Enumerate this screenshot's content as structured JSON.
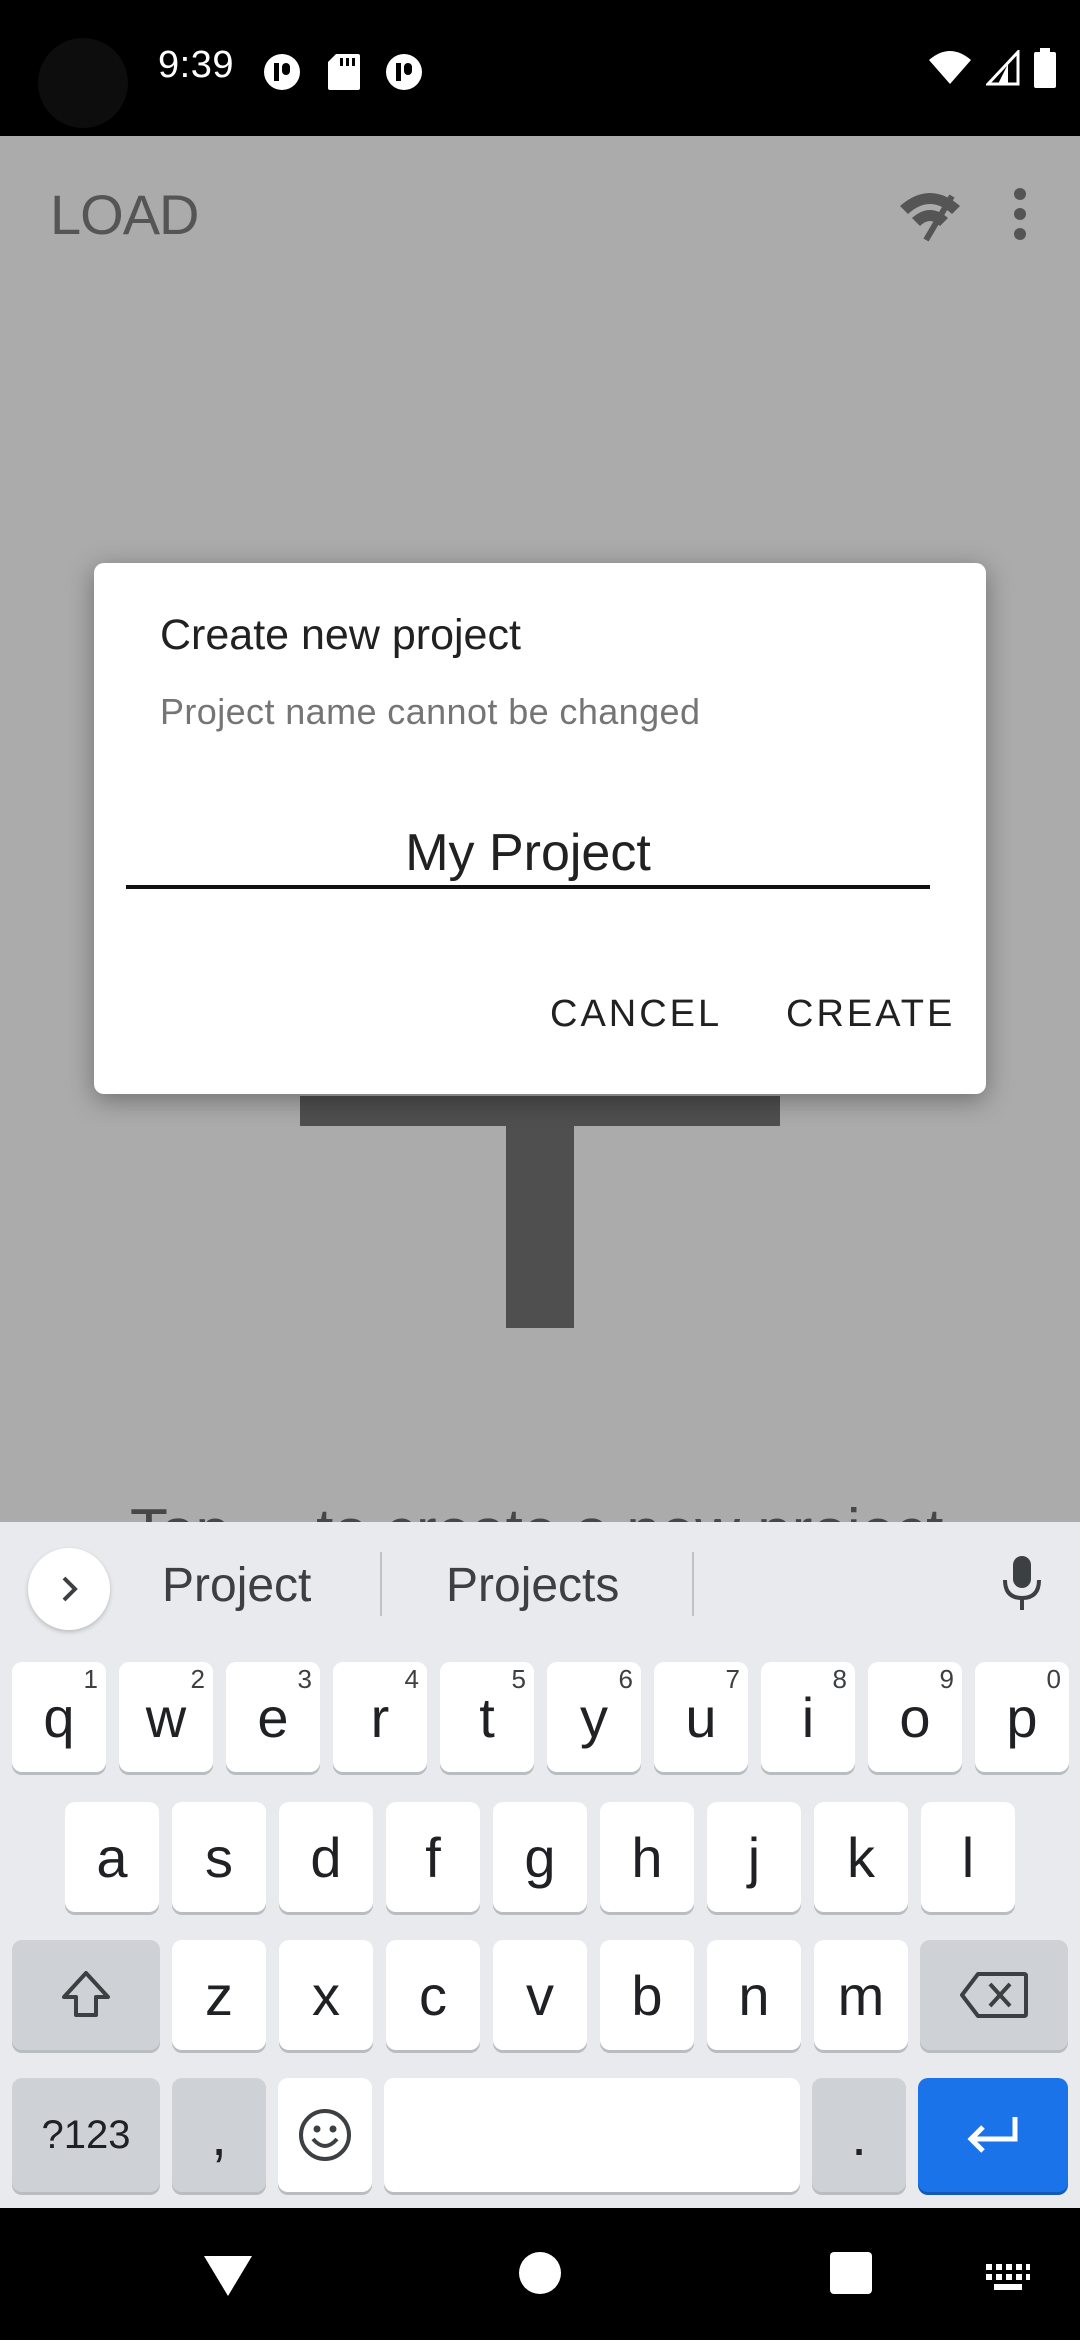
{
  "status_bar": {
    "time": "9:39",
    "notification_icons": [
      "notification-app-icon",
      "sd-card-icon",
      "notification-app-icon"
    ],
    "system_icons": [
      "wifi-icon",
      "cellular-signal-icon",
      "battery-icon"
    ]
  },
  "app_bar": {
    "title": "LOAD",
    "actions": [
      "wifi-off-icon",
      "more-vert-icon"
    ]
  },
  "background": {
    "partial_text": "Tap ... to create a new project"
  },
  "dialog": {
    "title": "Create new project",
    "subtitle": "Project name cannot be changed",
    "input_value": "My Project",
    "cancel_label": "CANCEL",
    "create_label": "CREATE"
  },
  "keyboard": {
    "suggestions": [
      "Project",
      "Projects"
    ],
    "row1": [
      {
        "label": "q",
        "hint": "1"
      },
      {
        "label": "w",
        "hint": "2"
      },
      {
        "label": "e",
        "hint": "3"
      },
      {
        "label": "r",
        "hint": "4"
      },
      {
        "label": "t",
        "hint": "5"
      },
      {
        "label": "y",
        "hint": "6"
      },
      {
        "label": "u",
        "hint": "7"
      },
      {
        "label": "i",
        "hint": "8"
      },
      {
        "label": "o",
        "hint": "9"
      },
      {
        "label": "p",
        "hint": "0"
      }
    ],
    "row2": [
      "a",
      "s",
      "d",
      "f",
      "g",
      "h",
      "j",
      "k",
      "l"
    ],
    "row3": [
      "z",
      "x",
      "c",
      "v",
      "b",
      "n",
      "m"
    ],
    "symbols_label": "?123",
    "comma_label": ",",
    "period_label": ".",
    "accent_color": "#1a73e8"
  },
  "nav_bar": {
    "buttons": [
      "back-icon",
      "home-icon",
      "recents-icon",
      "keyboard-switch-icon"
    ]
  }
}
